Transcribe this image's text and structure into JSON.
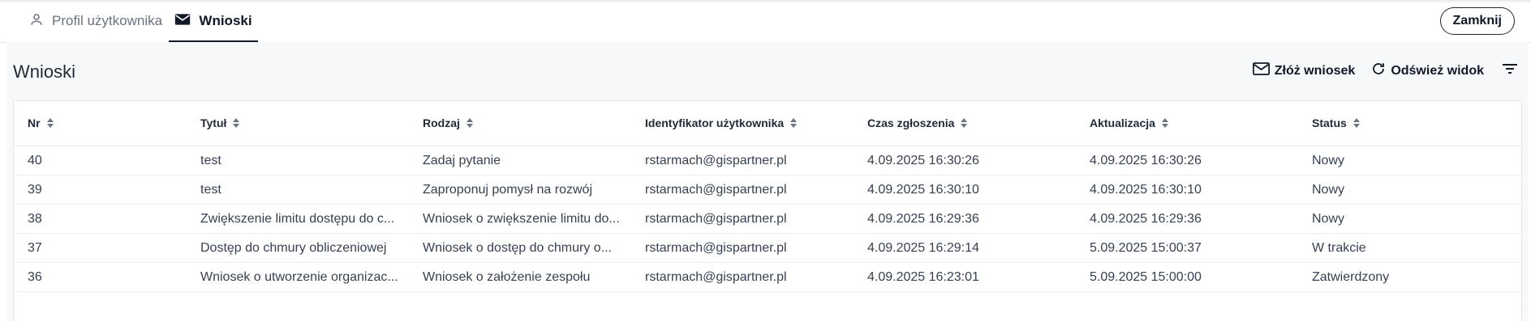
{
  "tabs": [
    {
      "label": "Profil użytkownika",
      "icon": "user-icon"
    },
    {
      "label": "Wnioski",
      "icon": "mail-icon"
    }
  ],
  "close_label": "Zamknij",
  "page_title": "Wnioski",
  "actions": {
    "submit_label": "Złóż wniosek",
    "refresh_label": "Odśwież widok"
  },
  "table": {
    "columns": [
      "Nr",
      "Tytuł",
      "Rodzaj",
      "Identyfikator użytkownika",
      "Czas zgłoszenia",
      "Aktualizacja",
      "Status"
    ],
    "rows": [
      [
        "40",
        "test",
        "Zadaj pytanie",
        "rstarmach@gispartner.pl",
        "4.09.2025 16:30:26",
        "4.09.2025 16:30:26",
        "Nowy"
      ],
      [
        "39",
        "test",
        "Zaproponuj pomysł na rozwój",
        "rstarmach@gispartner.pl",
        "4.09.2025 16:30:10",
        "4.09.2025 16:30:10",
        "Nowy"
      ],
      [
        "38",
        "Zwiększenie limitu dostępu do c...",
        "Wniosek o zwiększenie limitu do...",
        "rstarmach@gispartner.pl",
        "4.09.2025 16:29:36",
        "4.09.2025 16:29:36",
        "Nowy"
      ],
      [
        "37",
        "Dostęp do chmury obliczeniowej",
        "Wniosek o dostęp do chmury o...",
        "rstarmach@gispartner.pl",
        "4.09.2025 16:29:14",
        "5.09.2025 15:00:37",
        "W trakcie"
      ],
      [
        "36",
        "Wniosek o utworzenie organizac...",
        "Wniosek o założenie zespołu",
        "rstarmach@gispartner.pl",
        "4.09.2025 16:23:01",
        "5.09.2025 15:00:00",
        "Zatwierdzony"
      ]
    ]
  }
}
